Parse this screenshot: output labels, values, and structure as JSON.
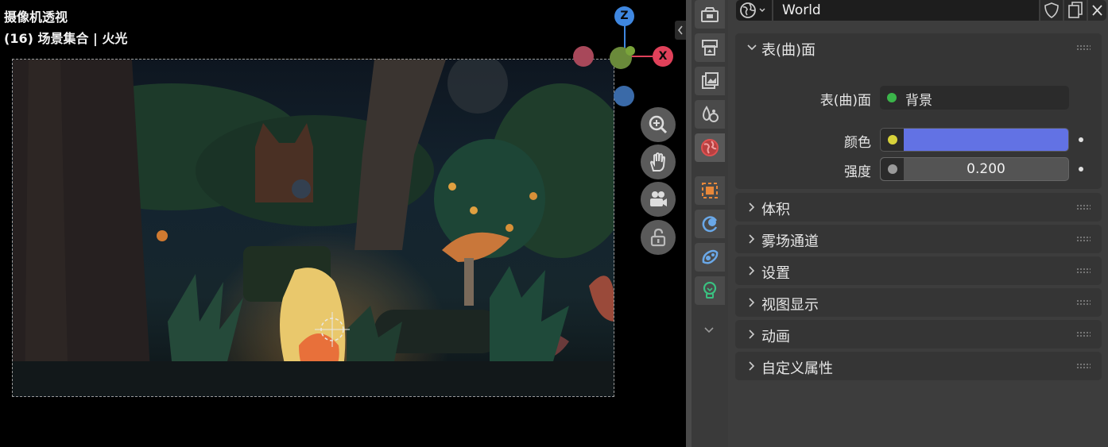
{
  "viewport": {
    "title": "摄像机透视",
    "subtitle": "(16) 场景集合 | 火光",
    "gizmo": {
      "z_label": "Z",
      "x_label": "X"
    },
    "nav_buttons": [
      "zoom-icon",
      "hand-icon",
      "camera-icon",
      "lock-icon"
    ]
  },
  "properties": {
    "world_name": "World",
    "tabs": [
      "render-tab",
      "output-tab",
      "view-layer-tab",
      "scene-tab",
      "world-tab",
      "object-tab",
      "physics-tab",
      "constraints-tab",
      "data-tab"
    ],
    "panels": {
      "surface": {
        "title": "表(曲)面",
        "surface_label": "表(曲)面",
        "surface_value": "背景",
        "color_label": "颜色",
        "color_value": "#6272e4",
        "strength_label": "强度",
        "strength_value": "0.200"
      },
      "volume": "体积",
      "mist": "雾场通道",
      "settings": "设置",
      "viewport_display": "视图显示",
      "animation": "动画",
      "custom_props": "自定义属性"
    }
  },
  "colors": {
    "accent_green": "#3bb54a",
    "accent_yellow": "#d8d23a",
    "x_axis": "#e0415a",
    "y_axis": "#7aa43a",
    "z_axis": "#3f87e0"
  }
}
